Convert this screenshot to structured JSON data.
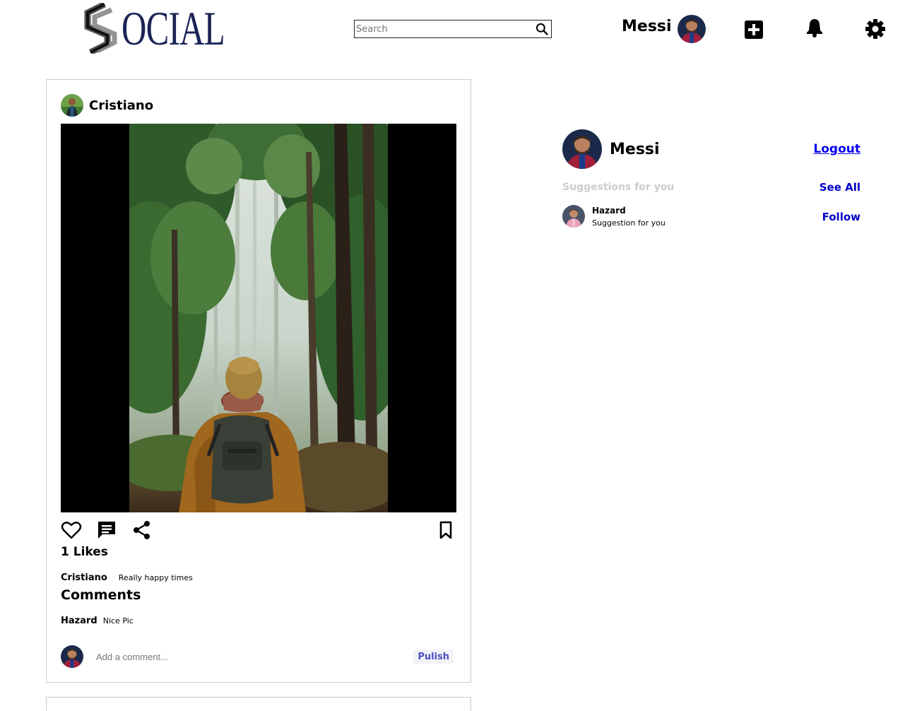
{
  "header": {
    "logo_text": "OCIAL",
    "logo_letter": "S",
    "search_placeholder": "Search",
    "username": "Messi",
    "icons": [
      "search-icon",
      "add-post-icon",
      "notification-bell-icon",
      "settings-gear-icon"
    ]
  },
  "post": {
    "author": "Cristiano",
    "image_alt": "Hiker with backpack in forest",
    "likes_text": "1 Likes",
    "caption_user": "Cristiano",
    "caption_text": "Really happy times",
    "comments_title": "Comments",
    "comments": [
      {
        "user": "Hazard",
        "text": "Nice Pic"
      }
    ],
    "add_comment_placeholder": "Add a comment...",
    "publish_label": "Pulish"
  },
  "sidebar": {
    "username": "Messi",
    "logout_label": "Logout",
    "suggestions_title": "Suggestions for you",
    "see_all_label": "See All",
    "suggestions": [
      {
        "name": "Hazard",
        "subtitle": "Suggestion for you",
        "action": "Follow"
      }
    ]
  },
  "colors": {
    "logo": "#1a2456",
    "link": "#0000ee",
    "action_link": "#0000cc",
    "publish": "#4b4bc8",
    "muted": "#cccccc",
    "card_border": "#cccccc"
  }
}
